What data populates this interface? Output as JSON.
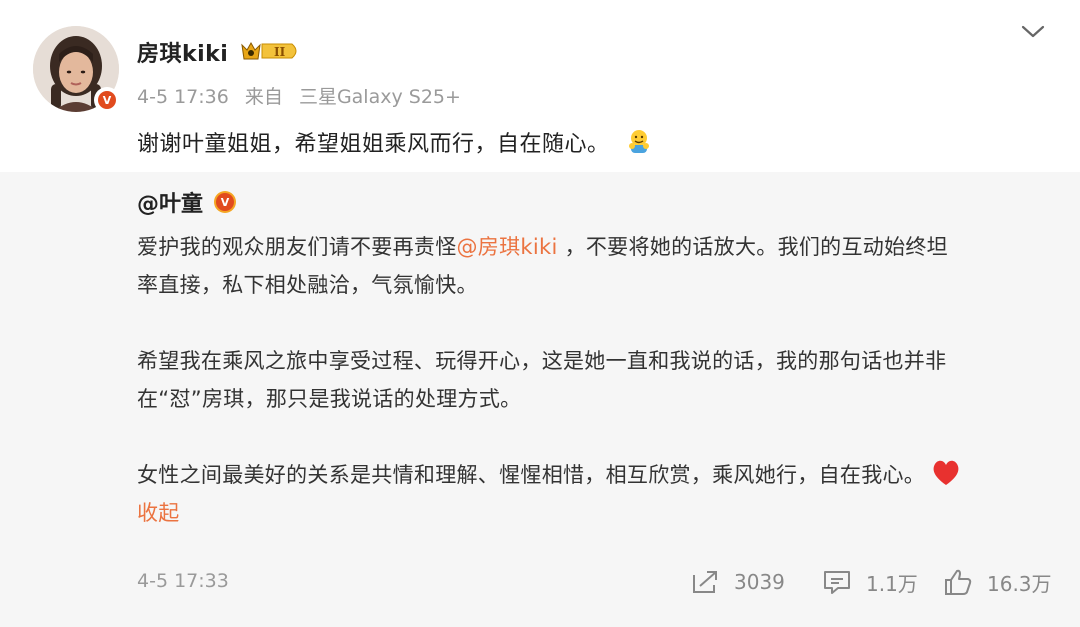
{
  "post": {
    "author": "房琪kiki",
    "vip_level": "II",
    "timestamp": "4-5 17:36",
    "source_prefix": "来自",
    "source_device": "三星Galaxy S25+",
    "text": "谢谢叶童姐姐，希望姐姐乘风而行，自在随心。",
    "emoji_icon": "hug-emoji-icon"
  },
  "repost": {
    "author": "@叶童",
    "p1_before": "爱护我的观众朋友们请不要再责怪",
    "p1_mention": "@房琪kiki",
    "p1_line1_after": " ，不要将她的话放大。我们的互动始终坦",
    "p1_line2": "率直接，私下相处融洽，气氛愉快。",
    "p2_line1": "希望我在乘风之旅中享受过程、玩得开心，这是她一直和我说的话，我的那句话也并非",
    "p2_line2": "在“怼”房琪，那只是我说话的处理方式。",
    "p3": "女性之间最美好的关系是共情和理解、惺惺相惜，相互欣赏，乘风她行，自在我心。",
    "collapse_label": "收起",
    "timestamp": "4-5 17:33",
    "reposts": "3039",
    "comments": "1.1万",
    "likes": "16.3万"
  },
  "colors": {
    "accent_orange": "#eb7340",
    "verified_gold": "#f5a623",
    "repost_bg": "#f6f6f6",
    "muted_text": "#9a9a9a"
  }
}
